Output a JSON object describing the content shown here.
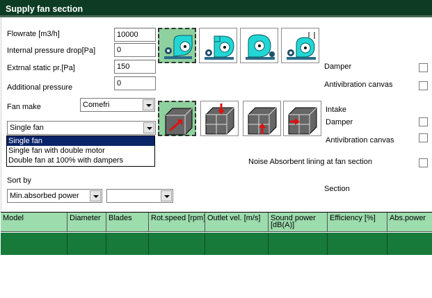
{
  "title": "Supply fan section",
  "form": {
    "flowrate_label": "Flowrate [m3/h]",
    "flowrate_value": "10000",
    "internal_drop_label": "Internal pressure drop[Pa]",
    "internal_drop_value": "0",
    "external_static_label": "Extrnal static pr.[Pa]",
    "external_static_value": "150",
    "additional_label": "Additional pressure",
    "additional_value": "0",
    "fan_make_label": "Fan make",
    "fan_make_value": "Comefri",
    "fan_type_value": "Single fan",
    "fan_type_options": [
      "Single fan",
      "Single fan with double motor",
      "Double fan at 100% with dampers"
    ],
    "sort_by_label": "Sort by",
    "sort_by_value": "Min.absorbed power",
    "sort_secondary_value": ""
  },
  "fan_tiles": [
    "fan-icon",
    "fan-icon",
    "fan-icon",
    "fan-icon"
  ],
  "intake_tiles": [
    "box-arrow-diagonal-icon",
    "box-arrow-top-icon",
    "box-arrow-bottom-icon",
    "box-arrow-side-icon"
  ],
  "right": {
    "damper1_label": "Damper",
    "antivib1_label": "Antivibration canvas",
    "intake_label": "Intake",
    "damper2_label": "Damper",
    "antivib2_label": "Antivibration canvas",
    "noise_label": "Noise Absorbent lining at fan section",
    "section_label": "Section"
  },
  "table": {
    "columns": [
      "Model",
      "Diameter",
      "Blades",
      "Rot.speed [rpm]",
      "Outlet vel. [m/s]",
      "Sound power\n[dB(A)]",
      "Efficiency [%]",
      "Abs.power"
    ],
    "row_color": "#177a3a",
    "header_color": "#9ddcad"
  },
  "colors": {
    "title_bg": "#0d3b24",
    "selected_tile": "#8fd19e",
    "fan_cyan": "#22d6d6",
    "arrow_red": "#e01010"
  }
}
